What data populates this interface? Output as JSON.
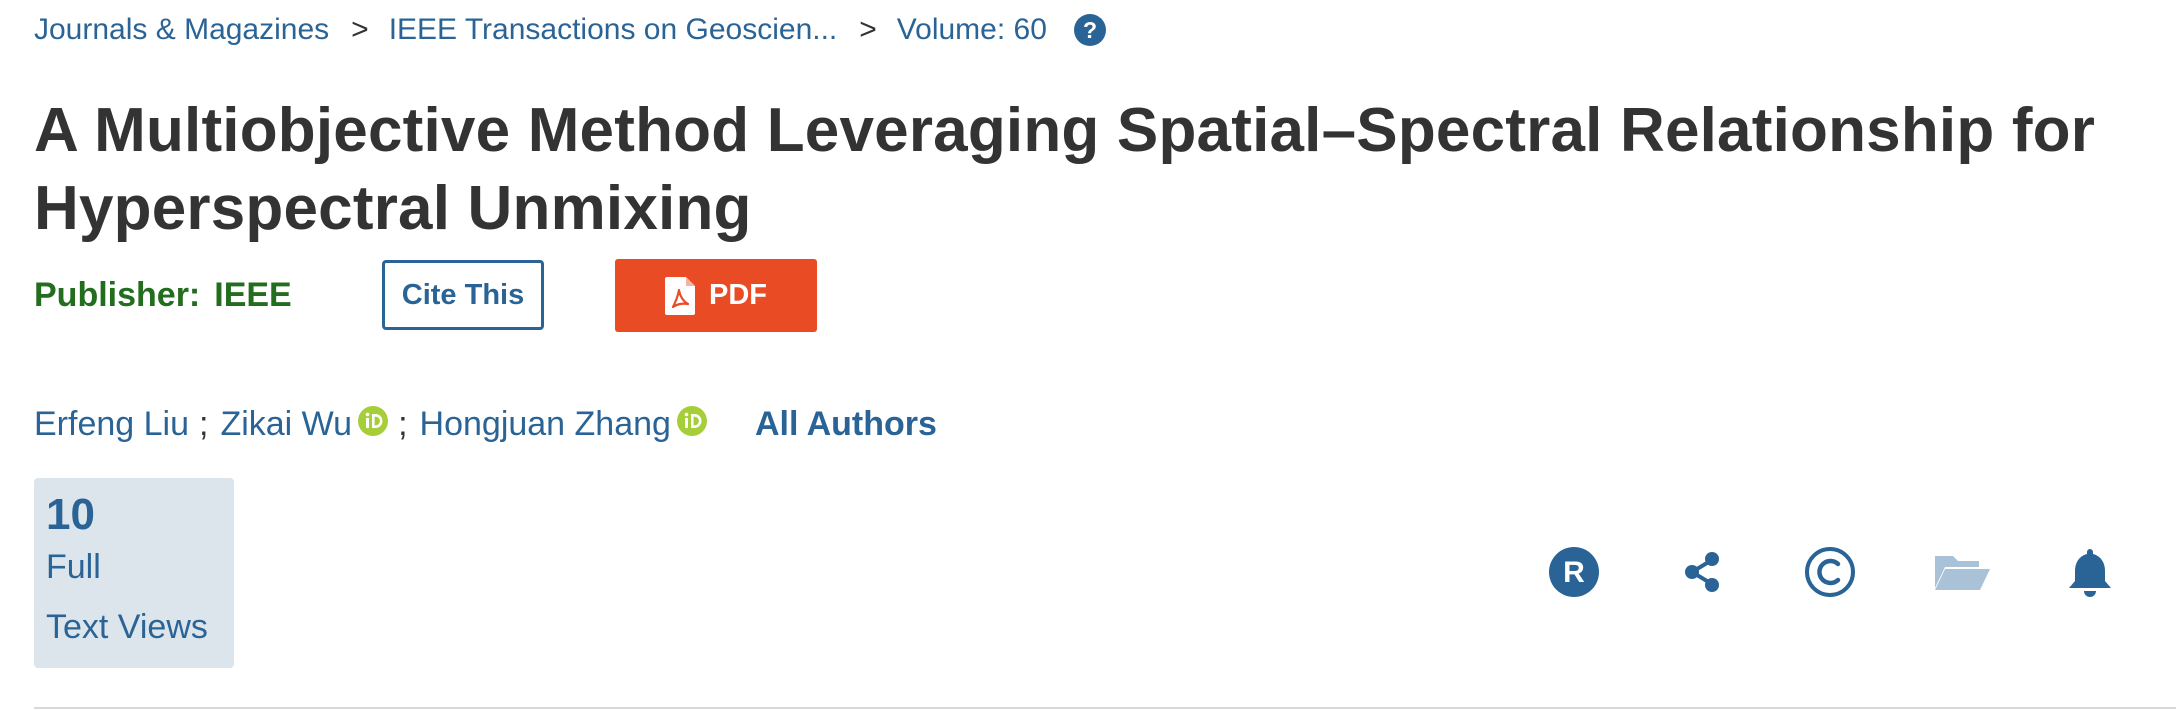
{
  "breadcrumb": {
    "items": [
      "Journals & Magazines",
      "IEEE Transactions on Geoscien...",
      "Volume: 60"
    ],
    "separator": ">",
    "help_icon": "question-circle-icon"
  },
  "article": {
    "title": "A Multiobjective Method Leveraging Spatial–Spectral Relationship for Hyperspectral Unmixing",
    "publisher_label": "Publisher:",
    "publisher_name": "IEEE",
    "cite_label": "Cite This",
    "pdf_label": "PDF",
    "pdf_icon": "pdf-file-icon"
  },
  "authors": {
    "list": [
      "Erfeng Liu",
      "Zikai Wu",
      "Hongjuan Zhang"
    ],
    "separator": ";",
    "orcid_icon": "orcid-icon",
    "all_authors_label": "All Authors"
  },
  "metrics": {
    "views_count": "10",
    "views_label_line1": "Full",
    "views_label_line2": "Text Views"
  },
  "actions": [
    "rights-icon",
    "share-icon",
    "copyright-icon",
    "folder-icon",
    "bell-icon"
  ],
  "colors": {
    "link": "#2a6496",
    "title": "#333333",
    "publisher": "#236d1e",
    "pdf_button": "#e94b25",
    "orcid": "#a6ce39",
    "views_bg": "#dde5ec",
    "folder_icon": "#a9c2d8"
  }
}
